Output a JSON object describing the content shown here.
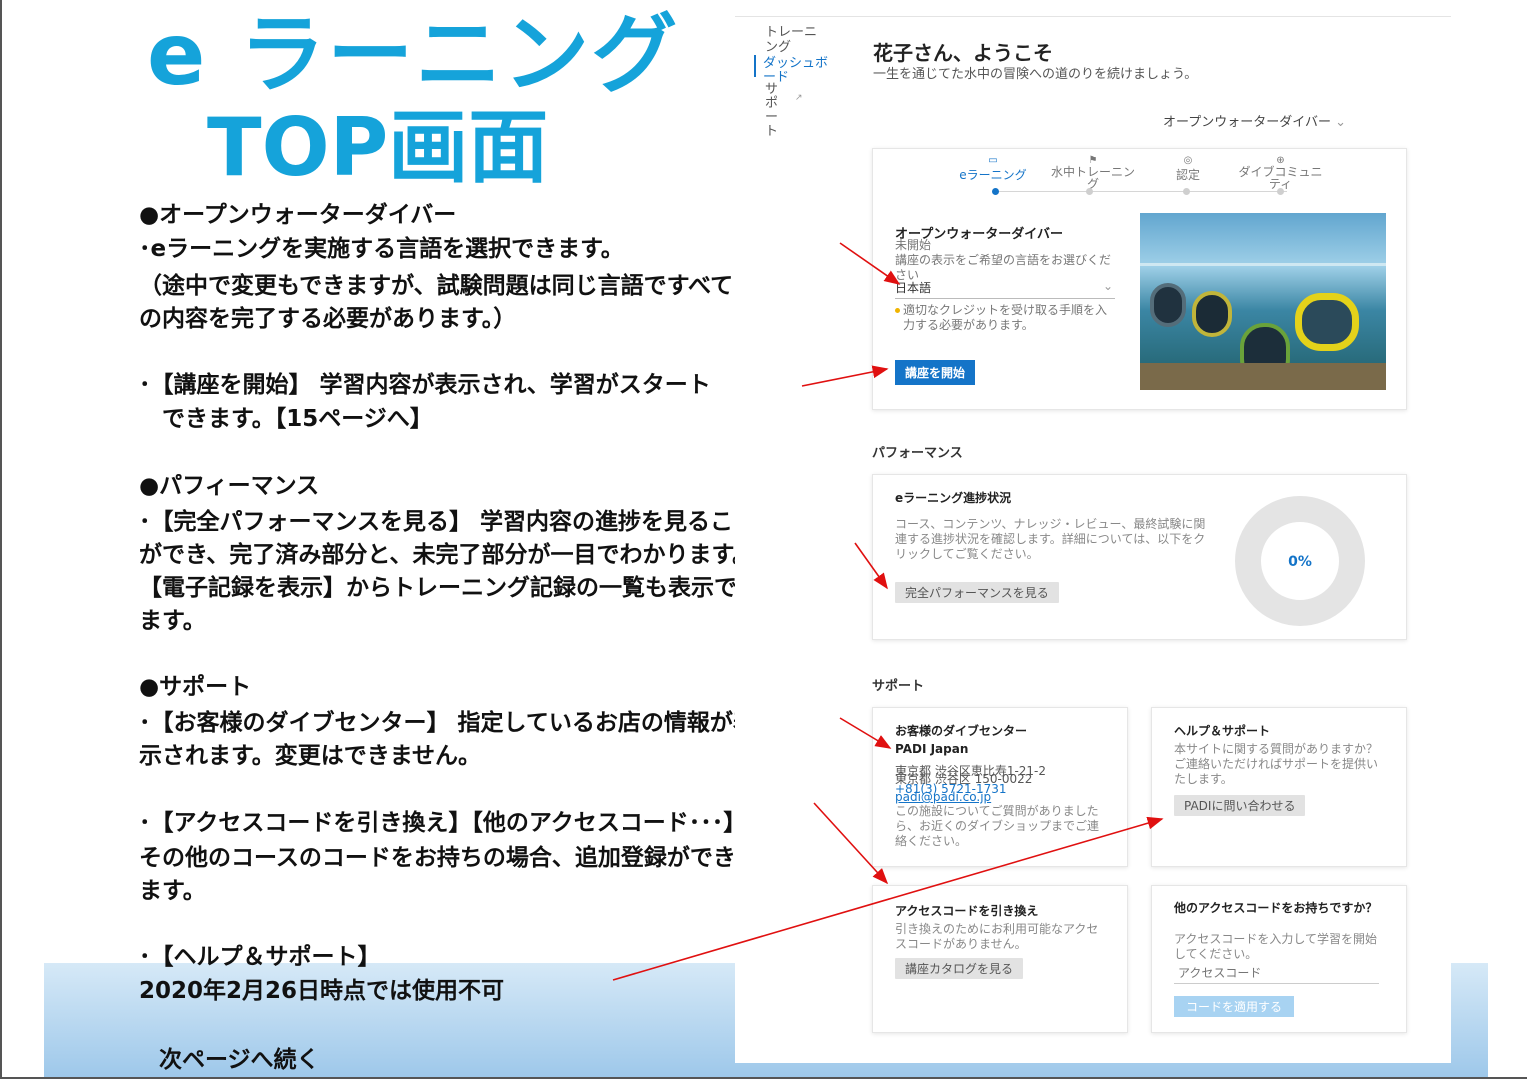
{
  "slide": {
    "title_line1": "e ラーニング",
    "title_line2": "TOP画面",
    "lines": [
      "●オープンウォーターダイバー",
      "･eラーニングを実施する言語を選択できます。",
      "（途中で変更もできますが、試験問題は同じ言語ですべて",
      "の内容を完了する必要があります。）",
      "･【講座を開始】 学習内容が表示され、学習がスタート",
      "　できます。【15ページへ】",
      "●パフィーマンス",
      "･【完全パフォーマンスを見る】 学習内容の進捗を見ること",
      "ができ、完了済み部分と、未完了部分が一目でわかります。",
      "【電子記録を表示】からトレーニング記録の一覧も表示でき",
      "ます。",
      "●サポート",
      "･【お客様のダイブセンター】 指定しているお店の情報が表",
      "示されます。変更はできません。",
      "･【アクセスコードを引き換え】【他のアクセスコード･･･】",
      "その他のコースのコードをお持ちの場合、追加登録ができ",
      "ます。",
      "･【ヘルプ＆サポート】",
      "2020年2月26日時点では使用不可"
    ],
    "next_page": "次ページへ続く",
    "title_color": "#15a3da",
    "arrow_color": "#e01010"
  },
  "screenshot": {
    "nav": {
      "training": "トレーニング",
      "dashboard": "ダッシュボード",
      "support": "サポート"
    },
    "greeting": "花子さん、ようこそ",
    "subtitle": "一生を通じてた水中の冒険への道のりを続けましょう。",
    "course_selector": "オープンウォーターダイバー",
    "tabs": [
      "eラーニング",
      "水中トレーニング",
      "認定",
      "ダイブコミュニティ"
    ],
    "course_card": {
      "title": "オープンウォーターダイバー",
      "status": "未開始",
      "language_prompt": "講座の表示をご希望の言語をお選びください",
      "language_value": "日本語",
      "credit_note": "適切なクレジットを受け取る手順を入力する必要があります。",
      "start_button": "講座を開始"
    },
    "performance": {
      "section_title": "パフォーマンス",
      "card_title": "eラーニング進捗状況",
      "body": "コース、コンテンツ、ナレッジ・レビュー、最終試験に関連する進捗状況を確認します。詳細については、以下をクリックしてご覧ください。",
      "button": "完全パフォーマンスを見る",
      "percent_label": "0%",
      "progress_percent": 0
    },
    "support": {
      "section_title": "サポート",
      "dive_center": {
        "title": "お客様のダイブセンター",
        "name": "PADI Japan",
        "address": "東京都 渋谷区恵比寿1-21-2",
        "postal": "東京都 渋谷区 150-0022",
        "phone": "+81(3) 5721-1731",
        "email": "padi@padi.co.jp",
        "note": "この施設についてご質問がありましたら、お近くのダイブショップまでご連絡ください。"
      },
      "help": {
        "title": "ヘルプ＆サポート",
        "body": "本サイトに関する質問がありますか？ご連絡いただければサポートを提供いたします。",
        "button": "PADIに問い合わせる"
      },
      "redeem": {
        "title": "アクセスコードを引き換え",
        "body": "引き換えのためにお利用可能なアクセスコードがありません。",
        "button": "講座カタログを見る"
      },
      "other_code": {
        "title": "他のアクセスコードをお持ちですか？",
        "body": "アクセスコードを入力して学習を開始してください。",
        "placeholder": "アクセスコード",
        "button": "コードを適用する"
      }
    }
  }
}
